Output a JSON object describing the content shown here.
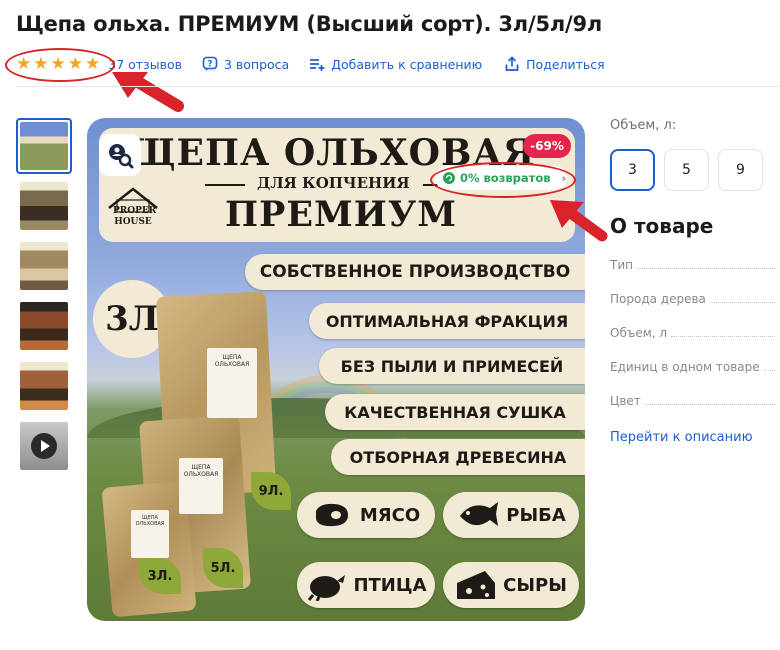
{
  "product": {
    "title": "Щепа ольха. ПРЕМИУМ (Высший сорт). 3л/5л/9л",
    "rating_stars": 5,
    "reviews": "37 отзывов",
    "questions": "3 вопроса",
    "compare": "Добавить к сравнению",
    "share": "Поделиться"
  },
  "gallery": {
    "thumb_count": 6,
    "active_index": 0,
    "video_thumb_index": 5
  },
  "hero": {
    "headline": "ЩЕПА ОЛЬХОВАЯ",
    "subheadline": "ДЛЯ КОПЧЕНИЯ",
    "premium": "ПРЕМИУМ",
    "brand_line1": "PROPER",
    "brand_line2": "HOUSE",
    "discount": "-69%",
    "returns": "0% возвратов",
    "volume_badge": "3Л",
    "features": [
      "СОБСТВЕННОЕ ПРОИЗВОДСТВО",
      "ОПТИМАЛЬНАЯ ФРАКЦИЯ",
      "БЕЗ ПЫЛИ И ПРИМЕСЕЙ",
      "КАЧЕСТВЕННАЯ СУШКА",
      "ОТБОРНАЯ ДРЕВЕСИНА"
    ],
    "uses": [
      "МЯСО",
      "РЫБА",
      "ПТИЦА",
      "СЫРЫ"
    ],
    "bag_labels": [
      "3Л.",
      "5Л.",
      "9Л."
    ],
    "bag_caption": "ЩЕПА ОЛЬХОВАЯ"
  },
  "options": {
    "label": "Объем, л:",
    "values": [
      "3",
      "5",
      "9"
    ],
    "selected_index": 0
  },
  "about": {
    "title": "О товаре",
    "specs": [
      "Тип",
      "Порода дерева",
      "Объем, л",
      "Единиц в одном товаре",
      "Цвет"
    ],
    "link": "Перейти к описанию"
  },
  "colors": {
    "accent": "#1a5fd1",
    "star": "#f5a524",
    "discount": "#e5254b",
    "returns": "#27a35a",
    "annotation": "#d8232a"
  }
}
